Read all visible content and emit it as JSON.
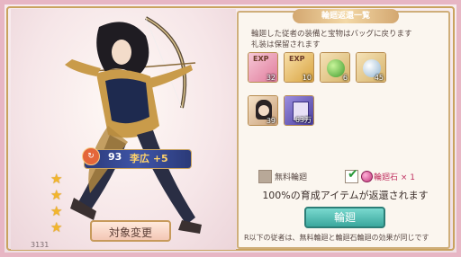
{
  "panel": {
    "title": "輪廻返還一覧",
    "description": "輪廻した従者の装備と宝物はバッグに戻ります\n礼装は保留されます"
  },
  "items": [
    {
      "name": "exp-potion-pink",
      "label": "EXP",
      "count": "32",
      "color": "#e89ab2"
    },
    {
      "name": "exp-potion-gold",
      "label": "EXP",
      "count": "10",
      "color": "#e8c070"
    },
    {
      "name": "green-orb",
      "label": "",
      "count": "6",
      "color": "#6fbf5a"
    },
    {
      "name": "silver-orb",
      "label": "",
      "count": "45",
      "color": "#b9d4e6"
    },
    {
      "name": "character-card",
      "label": "",
      "count": "39",
      "color": "#d9b58a"
    },
    {
      "name": "purple-scroll",
      "label": "",
      "count": "63万",
      "color": "#6a5db8"
    }
  ],
  "options": {
    "free_label": "無料輪廻",
    "stone_label": "輪廻石 × 1"
  },
  "return_text": "100%の育成アイテムが返還されます",
  "buttons": {
    "execute": "輪廻",
    "change_target": "対象変更"
  },
  "note": "R以下の従者は、無料輪廻と輪廻石輪廻の効果が同じです",
  "hero": {
    "level": "93",
    "name": "李広 +5",
    "stars": 4,
    "power": "3131"
  },
  "colors": {
    "accent_gold": "#c9a35f",
    "name_bar": "#2b3a78",
    "button_teal": "#3aa79d"
  }
}
